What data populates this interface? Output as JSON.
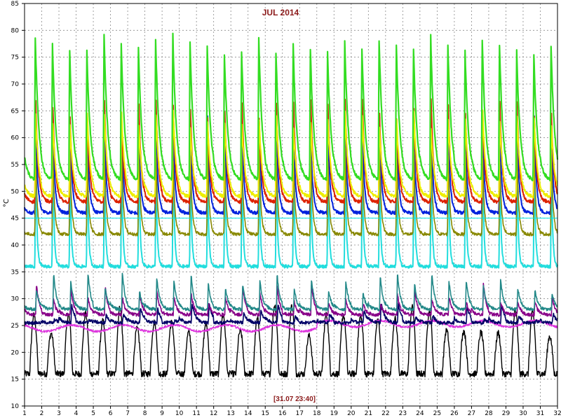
{
  "chart_data": {
    "type": "line",
    "title": "JUL 2014",
    "footer": "[31.07 23:40]",
    "ylabel": "°C",
    "xlabel": "",
    "xlim": [
      1,
      32
    ],
    "ylim": [
      10,
      85
    ],
    "x_ticks": [
      1,
      2,
      3,
      4,
      5,
      6,
      7,
      8,
      9,
      10,
      11,
      12,
      13,
      14,
      15,
      16,
      17,
      18,
      19,
      20,
      21,
      22,
      23,
      24,
      25,
      26,
      27,
      28,
      29,
      30,
      31,
      32
    ],
    "y_ticks": [
      10,
      15,
      20,
      25,
      30,
      35,
      40,
      45,
      50,
      55,
      60,
      65,
      70,
      75,
      80,
      85
    ],
    "grid": true,
    "legend": "none",
    "colors": {
      "title": "#8b1a1a",
      "footer": "#8b1a1a",
      "grid": "#8a8a8a",
      "highlight_line": "#00e5e5"
    },
    "series": [
      {
        "color": "#33dd22",
        "width": 2.2,
        "profile": {
          "type": "daily",
          "base": 52,
          "peak": 78,
          "phase": 0.58,
          "decay": 0.62
        }
      },
      {
        "color": "#eeee00",
        "width": 2.0,
        "profile": {
          "type": "daily",
          "base": 49,
          "peak": 64,
          "phase": 0.6,
          "decay": 0.55
        }
      },
      {
        "color": "#dd2200",
        "width": 2.0,
        "profile": {
          "type": "daily",
          "base": 48,
          "peak": 66,
          "phase": 0.6,
          "decay": 0.45
        }
      },
      {
        "color": "#888800",
        "width": 1.6,
        "profile": {
          "type": "daily",
          "base": 42,
          "peak": 58,
          "phase": 0.6,
          "decay": 0.3
        }
      },
      {
        "color": "#0022dd",
        "width": 2.0,
        "profile": {
          "type": "daily",
          "base": 46,
          "peak": 63,
          "phase": 0.6,
          "decay": 0.35
        }
      },
      {
        "color": "#22dddd",
        "width": 2.0,
        "profile": {
          "type": "daily",
          "base": 36,
          "peak": 58,
          "phase": 0.6,
          "decay": 0.22
        }
      },
      {
        "color": "#228888",
        "width": 1.6,
        "profile": {
          "type": "daily",
          "base": 28,
          "peak": 33,
          "phase": 0.65,
          "decay": 0.5
        }
      },
      {
        "color": "#880088",
        "width": 1.6,
        "profile": {
          "type": "daily",
          "base": 27,
          "peak": 31,
          "phase": 0.65,
          "decay": 0.5
        }
      },
      {
        "color": "#000066",
        "width": 1.6,
        "profile": {
          "type": "daily",
          "base": 25.5,
          "peak": 27.5,
          "phase": 0.7,
          "decay": 0.6
        }
      },
      {
        "color": "#dd33dd",
        "width": 1.4,
        "profile": {
          "type": "flat",
          "base": 24.5,
          "amp": 0.6
        }
      },
      {
        "color": "#000000",
        "width": 1.4,
        "profile": {
          "type": "ambient",
          "base": 16,
          "peak": 26
        }
      }
    ],
    "highlight_y": 45
  }
}
